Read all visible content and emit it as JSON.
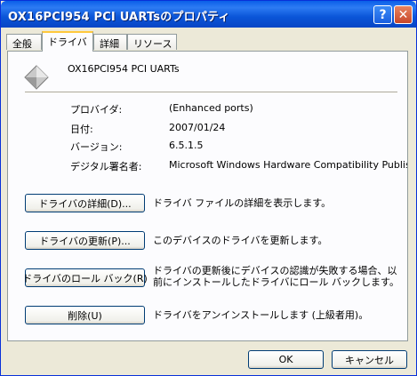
{
  "window": {
    "title": "OX16PCI954 PCI UARTsのプロパティ",
    "help_icon": "?",
    "close_icon": "✕"
  },
  "tabs": [
    {
      "label": "全般"
    },
    {
      "label": "ドライバ"
    },
    {
      "label": "詳細"
    },
    {
      "label": "リソース"
    }
  ],
  "device": {
    "name": "OX16PCI954 PCI UARTs",
    "icon": "device-diamond-icon"
  },
  "properties": [
    {
      "label": "プロバイダ:",
      "value": "(Enhanced ports)"
    },
    {
      "label": "日付:",
      "value": "2007/01/24"
    },
    {
      "label": "バージョン:",
      "value": "6.5.1.5"
    },
    {
      "label": "デジタル署名者:",
      "value": "Microsoft Windows Hardware Compatibility Publishe"
    }
  ],
  "actions": [
    {
      "button": "ドライバの詳細(D)...",
      "description": "ドライバ ファイルの詳細を表示します。"
    },
    {
      "button": "ドライバの更新(P)...",
      "description": "このデバイスのドライバを更新します。"
    },
    {
      "button": "ドライバのロール バック(R)",
      "description_line1": "ドライバの更新後にデバイスの認識が失敗する場合、以",
      "description_line2": "前にインストールしたドライバにロール バックします。"
    },
    {
      "button": "削除(U)",
      "description": "ドライバをアンインストールします (上級者用)。"
    }
  ],
  "footer": {
    "ok": "OK",
    "cancel": "キャンセル"
  },
  "colors": {
    "titlebar": "#0A55D8",
    "active_tab_accent": "#FFC83C",
    "dialog_bg": "#ECE9D8",
    "button_border": "#003C74"
  }
}
